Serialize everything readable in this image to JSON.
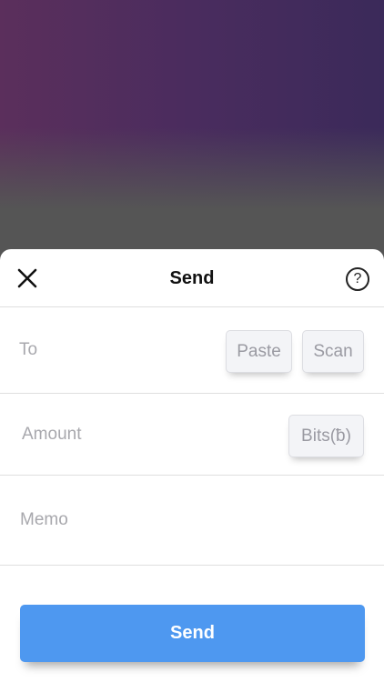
{
  "header": {
    "title": "Send",
    "help_glyph": "?",
    "close_icon": "close-icon",
    "help_icon": "help-icon"
  },
  "fields": {
    "to": {
      "placeholder": "To",
      "value": ""
    },
    "amount": {
      "placeholder": "Amount",
      "value": ""
    },
    "memo": {
      "placeholder": "Memo",
      "value": ""
    }
  },
  "buttons": {
    "paste": "Paste",
    "scan": "Scan",
    "unit": "Bits(ƀ)",
    "send": "Send"
  },
  "colors": {
    "accent": "#4e98f0",
    "backdrop_top": "#5b2f5c",
    "backdrop_bottom": "#555555"
  }
}
